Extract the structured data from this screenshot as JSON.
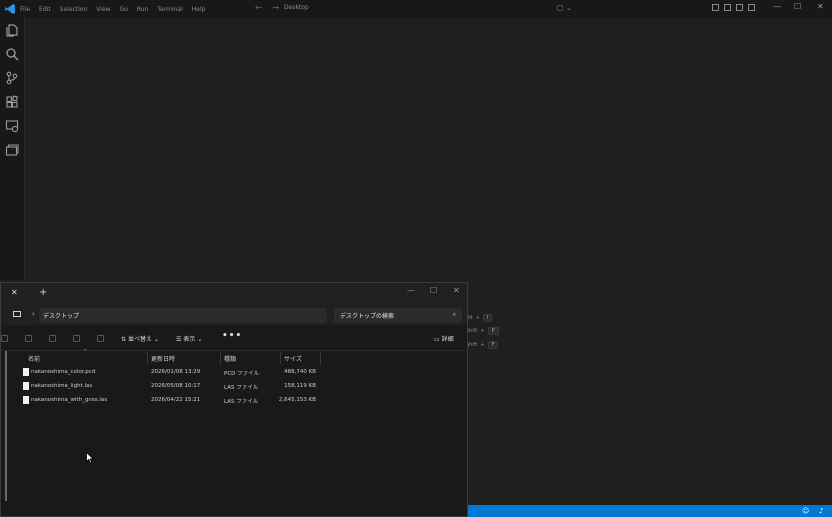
{
  "vscode": {
    "menu": [
      "File",
      "Edit",
      "Selection",
      "View",
      "Go",
      "Run",
      "Terminal",
      "Help"
    ],
    "title": "Desktop",
    "nav_arrows": "← →",
    "shortcut_hints": [
      {
        "label": "Alt",
        "k1": "+",
        "k2": "I"
      },
      {
        "label": "Shift",
        "k1": "+",
        "k2": "P"
      },
      {
        "label": "Shift",
        "k1": "+",
        "k2": "F"
      }
    ]
  },
  "explorer": {
    "tab_close": "✕",
    "new_tab": "+",
    "address": "デスクトップ",
    "search_placeholder": "デスクトップの検索",
    "toolbar": {
      "sort_label": "並べ替え",
      "view_label": "表示",
      "more": "•••",
      "details_label": "詳細"
    },
    "columns": {
      "name": "名前",
      "modified": "更新日時",
      "type": "種類",
      "size": "サイズ"
    },
    "files": [
      {
        "name": "nakanoshima_color.pcd",
        "modified": "2026/01/08 13:29",
        "type": "PCD ファイル",
        "size": "488,740 KB"
      },
      {
        "name": "nakanoshima_light.las",
        "modified": "2026/05/08 10:17",
        "type": "LAS ファイル",
        "size": "158,119 KB"
      },
      {
        "name": "nakanoshima_with_gnss.las",
        "modified": "2026/04/22 15:21",
        "type": "LAS ファイル",
        "size": "2,645,153 KB"
      }
    ]
  },
  "colors": {
    "statusbar": "#0078d4",
    "editor_bg": "#1f1f1f",
    "explorer_bg": "#191919"
  }
}
